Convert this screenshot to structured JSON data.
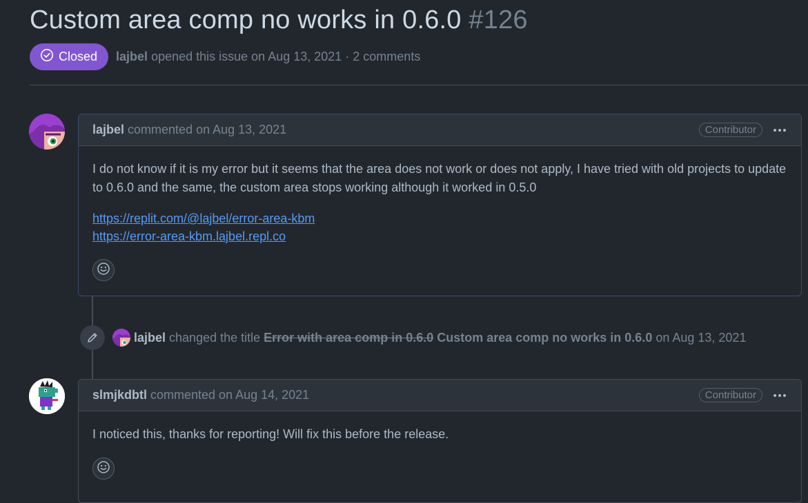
{
  "issue": {
    "title": "Custom area comp no works in 0.6.0",
    "number": "#126",
    "state": "Closed",
    "author": "lajbel",
    "opened_text": "opened this issue on Aug 13, 2021 · 2 comments"
  },
  "comments": [
    {
      "author": "lajbel",
      "action_text": "commented on Aug 13, 2021",
      "role": "Contributor",
      "body": "I do not know if it is my error but it seems that the area does not work or does not apply, I have tried with old projects to update to 0.6.0 and the same, the custom area stops working although it worked in 0.5.0",
      "links": [
        "https://replit.com/@lajbel/error-area-kbm",
        "https://error-area-kbm.lajbel.repl.co"
      ]
    },
    {
      "author": "slmjkdbtl",
      "action_text": "commented on Aug 14, 2021",
      "role": "Contributor",
      "body": "I noticed this, thanks for reporting! Will fix this before the release."
    }
  ],
  "event": {
    "author": "lajbel",
    "action": "changed the title",
    "old_title": "Error with area comp in 0.6.0",
    "new_title": "Custom area comp no works in 0.6.0",
    "date": "on Aug 13, 2021"
  },
  "colors": {
    "background": "#22272e",
    "closed_badge": "#8256d0",
    "link": "#539bf5",
    "author_comment_border": "#384b6b"
  },
  "icons": [
    "closed-issue-icon",
    "pencil-icon",
    "smiley-icon",
    "kebab-icon"
  ]
}
